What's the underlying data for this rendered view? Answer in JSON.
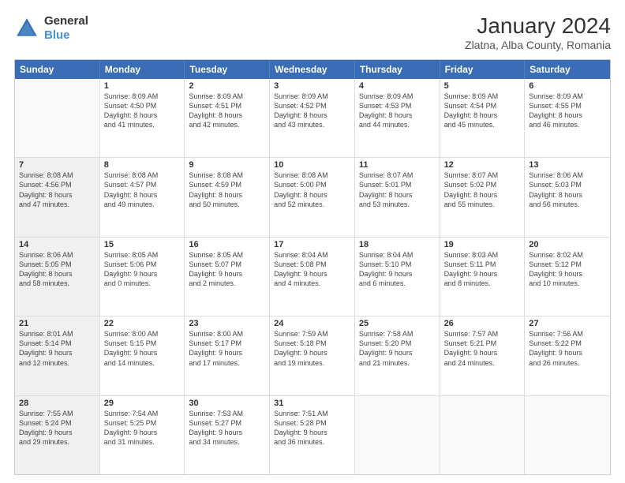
{
  "header": {
    "logo_general": "General",
    "logo_blue": "Blue",
    "title": "January 2024",
    "subtitle": "Zlatna, Alba County, Romania"
  },
  "calendar": {
    "days_of_week": [
      "Sunday",
      "Monday",
      "Tuesday",
      "Wednesday",
      "Thursday",
      "Friday",
      "Saturday"
    ],
    "rows": [
      [
        {
          "day": "",
          "info": "",
          "empty": true
        },
        {
          "day": "1",
          "info": "Sunrise: 8:09 AM\nSunset: 4:50 PM\nDaylight: 8 hours\nand 41 minutes."
        },
        {
          "day": "2",
          "info": "Sunrise: 8:09 AM\nSunset: 4:51 PM\nDaylight: 8 hours\nand 42 minutes."
        },
        {
          "day": "3",
          "info": "Sunrise: 8:09 AM\nSunset: 4:52 PM\nDaylight: 8 hours\nand 43 minutes."
        },
        {
          "day": "4",
          "info": "Sunrise: 8:09 AM\nSunset: 4:53 PM\nDaylight: 8 hours\nand 44 minutes."
        },
        {
          "day": "5",
          "info": "Sunrise: 8:09 AM\nSunset: 4:54 PM\nDaylight: 8 hours\nand 45 minutes."
        },
        {
          "day": "6",
          "info": "Sunrise: 8:09 AM\nSunset: 4:55 PM\nDaylight: 8 hours\nand 46 minutes."
        }
      ],
      [
        {
          "day": "7",
          "info": "Sunrise: 8:08 AM\nSunset: 4:56 PM\nDaylight: 8 hours\nand 47 minutes.",
          "shaded": true
        },
        {
          "day": "8",
          "info": "Sunrise: 8:08 AM\nSunset: 4:57 PM\nDaylight: 8 hours\nand 49 minutes."
        },
        {
          "day": "9",
          "info": "Sunrise: 8:08 AM\nSunset: 4:59 PM\nDaylight: 8 hours\nand 50 minutes."
        },
        {
          "day": "10",
          "info": "Sunrise: 8:08 AM\nSunset: 5:00 PM\nDaylight: 8 hours\nand 52 minutes."
        },
        {
          "day": "11",
          "info": "Sunrise: 8:07 AM\nSunset: 5:01 PM\nDaylight: 8 hours\nand 53 minutes."
        },
        {
          "day": "12",
          "info": "Sunrise: 8:07 AM\nSunset: 5:02 PM\nDaylight: 8 hours\nand 55 minutes."
        },
        {
          "day": "13",
          "info": "Sunrise: 8:06 AM\nSunset: 5:03 PM\nDaylight: 8 hours\nand 56 minutes."
        }
      ],
      [
        {
          "day": "14",
          "info": "Sunrise: 8:06 AM\nSunset: 5:05 PM\nDaylight: 8 hours\nand 58 minutes.",
          "shaded": true
        },
        {
          "day": "15",
          "info": "Sunrise: 8:05 AM\nSunset: 5:06 PM\nDaylight: 9 hours\nand 0 minutes."
        },
        {
          "day": "16",
          "info": "Sunrise: 8:05 AM\nSunset: 5:07 PM\nDaylight: 9 hours\nand 2 minutes."
        },
        {
          "day": "17",
          "info": "Sunrise: 8:04 AM\nSunset: 5:08 PM\nDaylight: 9 hours\nand 4 minutes."
        },
        {
          "day": "18",
          "info": "Sunrise: 8:04 AM\nSunset: 5:10 PM\nDaylight: 9 hours\nand 6 minutes."
        },
        {
          "day": "19",
          "info": "Sunrise: 8:03 AM\nSunset: 5:11 PM\nDaylight: 9 hours\nand 8 minutes."
        },
        {
          "day": "20",
          "info": "Sunrise: 8:02 AM\nSunset: 5:12 PM\nDaylight: 9 hours\nand 10 minutes."
        }
      ],
      [
        {
          "day": "21",
          "info": "Sunrise: 8:01 AM\nSunset: 5:14 PM\nDaylight: 9 hours\nand 12 minutes.",
          "shaded": true
        },
        {
          "day": "22",
          "info": "Sunrise: 8:00 AM\nSunset: 5:15 PM\nDaylight: 9 hours\nand 14 minutes."
        },
        {
          "day": "23",
          "info": "Sunrise: 8:00 AM\nSunset: 5:17 PM\nDaylight: 9 hours\nand 17 minutes."
        },
        {
          "day": "24",
          "info": "Sunrise: 7:59 AM\nSunset: 5:18 PM\nDaylight: 9 hours\nand 19 minutes."
        },
        {
          "day": "25",
          "info": "Sunrise: 7:58 AM\nSunset: 5:20 PM\nDaylight: 9 hours\nand 21 minutes."
        },
        {
          "day": "26",
          "info": "Sunrise: 7:57 AM\nSunset: 5:21 PM\nDaylight: 9 hours\nand 24 minutes."
        },
        {
          "day": "27",
          "info": "Sunrise: 7:56 AM\nSunset: 5:22 PM\nDaylight: 9 hours\nand 26 minutes."
        }
      ],
      [
        {
          "day": "28",
          "info": "Sunrise: 7:55 AM\nSunset: 5:24 PM\nDaylight: 9 hours\nand 29 minutes.",
          "shaded": true
        },
        {
          "day": "29",
          "info": "Sunrise: 7:54 AM\nSunset: 5:25 PM\nDaylight: 9 hours\nand 31 minutes."
        },
        {
          "day": "30",
          "info": "Sunrise: 7:53 AM\nSunset: 5:27 PM\nDaylight: 9 hours\nand 34 minutes."
        },
        {
          "day": "31",
          "info": "Sunrise: 7:51 AM\nSunset: 5:28 PM\nDaylight: 9 hours\nand 36 minutes."
        },
        {
          "day": "",
          "info": "",
          "empty": true
        },
        {
          "day": "",
          "info": "",
          "empty": true
        },
        {
          "day": "",
          "info": "",
          "empty": true
        }
      ]
    ]
  }
}
